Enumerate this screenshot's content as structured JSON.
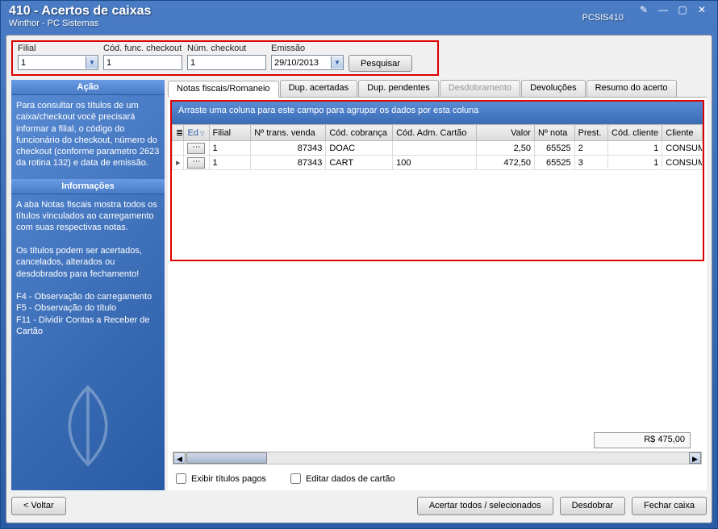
{
  "window": {
    "title": "410 - Acertos de caixas",
    "subtitle": "Winthor - PC Sistemas",
    "code": "PCSIS410"
  },
  "filters": {
    "filial": {
      "label": "Filial",
      "value": "1"
    },
    "cod_func": {
      "label": "Cód. func. checkout",
      "value": "1"
    },
    "num_checkout": {
      "label": "Núm. checkout",
      "value": "1"
    },
    "emissao": {
      "label": "Emissão",
      "value": "29/10/2013"
    },
    "pesquisar": "Pesquisar"
  },
  "sidebar": {
    "acao": {
      "title": "Ação",
      "text": "Para consultar os títulos de um caixa/checkout você precisará informar a filial, o código do funcionário do checkout, número do checkout (conforme parametro 2623 da rotina 132) e data de emissão."
    },
    "info": {
      "title": "Informações",
      "text1": "A aba Notas fiscais mostra todos os títulos vinculados ao carregamento com suas respectivas notas.",
      "text2": "Os títulos podem ser acertados, cancelados, alterados ou desdobrados para fechamento!",
      "text3": "F4 - Observação do carregamento\nF5 - Observação do título\nF11 - Dividir Contas a Receber de Cartão"
    }
  },
  "tabs": {
    "t0": "Notas fiscais/Romaneio",
    "t1": "Dup. acertadas",
    "t2": "Dup. pendentes",
    "t3": "Desdobramento",
    "t4": "Devoluções",
    "t5": "Resumo do acerto"
  },
  "grid": {
    "group_hint": "Arraste uma coluna para este campo para agrupar os dados por esta coluna",
    "headers": {
      "ed": "Ed",
      "filial": "Filial",
      "trans": "Nº trans. venda",
      "cobranca": "Cód. cobrança",
      "cartao": "Cód. Adm. Cartão",
      "valor": "Valor",
      "nota": "Nº nota",
      "prest": "Prest.",
      "codcli": "Cód. cliente",
      "cliente": "Cliente"
    },
    "rows": [
      {
        "filial": "1",
        "trans": "87343",
        "cobranca": "DOAC",
        "cartao": "",
        "valor": "2,50",
        "nota": "65525",
        "prest": "2",
        "codcli": "1",
        "cliente": "CONSUM"
      },
      {
        "filial": "1",
        "trans": "87343",
        "cobranca": "CART",
        "cartao": "100",
        "valor": "472,50",
        "nota": "65525",
        "prest": "3",
        "codcli": "1",
        "cliente": "CONSUM"
      }
    ],
    "total": "R$ 475,00"
  },
  "checks": {
    "pagos": "Exibir títulos pagos",
    "cartao": "Editar dados de cartão"
  },
  "buttons": {
    "voltar": "< Voltar",
    "acertar": "Acertar todos / selecionados",
    "desdobrar": "Desdobrar",
    "fechar": "Fechar caixa"
  }
}
